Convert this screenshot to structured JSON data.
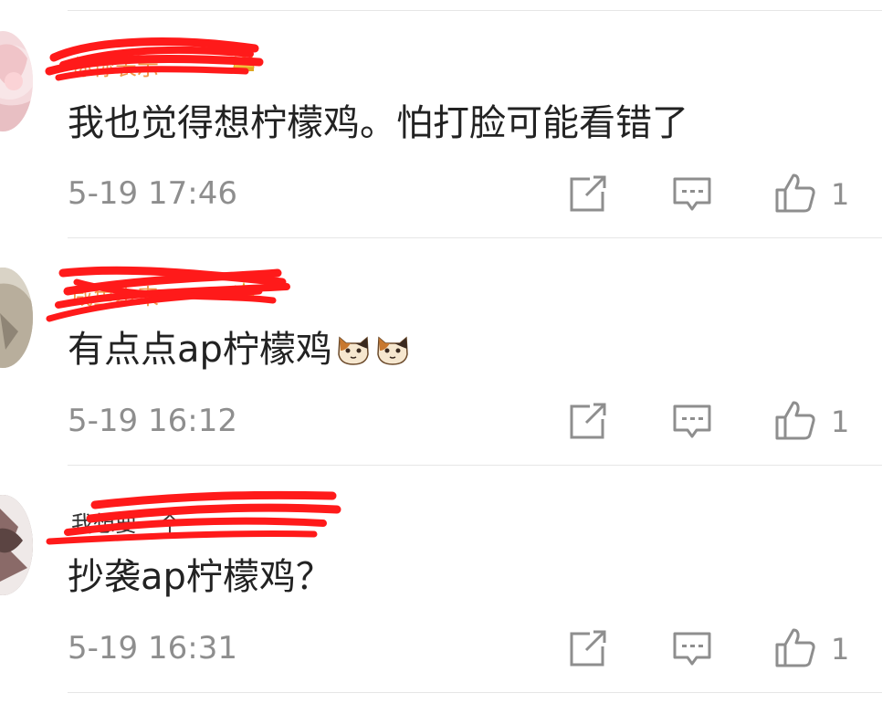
{
  "comments": [
    {
      "username": "你你表示",
      "text": "我也觉得想柠檬鸡。怕打脸可能看错了",
      "timestamp": "5-19 17:46",
      "like_count": "1",
      "avatar_color": "#f4d9dc"
    },
    {
      "username": "咸鱼本来",
      "text": "有点点ap柠檬鸡",
      "emojis": [
        "cat-emoji",
        "cat-emoji"
      ],
      "timestamp": "5-19 16:12",
      "like_count": "1",
      "avatar_color": "#c8c2b5"
    },
    {
      "username": "我想要一个",
      "text": "抄袭ap柠檬鸡？",
      "timestamp": "5-19 16:31",
      "like_count": "1",
      "avatar_color": "#9a8a88"
    }
  ],
  "icons": {
    "share": "share-icon",
    "comment": "comment-icon",
    "like": "like-icon",
    "crown": "crown-icon"
  },
  "colors": {
    "redaction": "#ff1a1a",
    "username": "#f2994a",
    "text": "#222222",
    "meta": "#8e8e8e"
  }
}
